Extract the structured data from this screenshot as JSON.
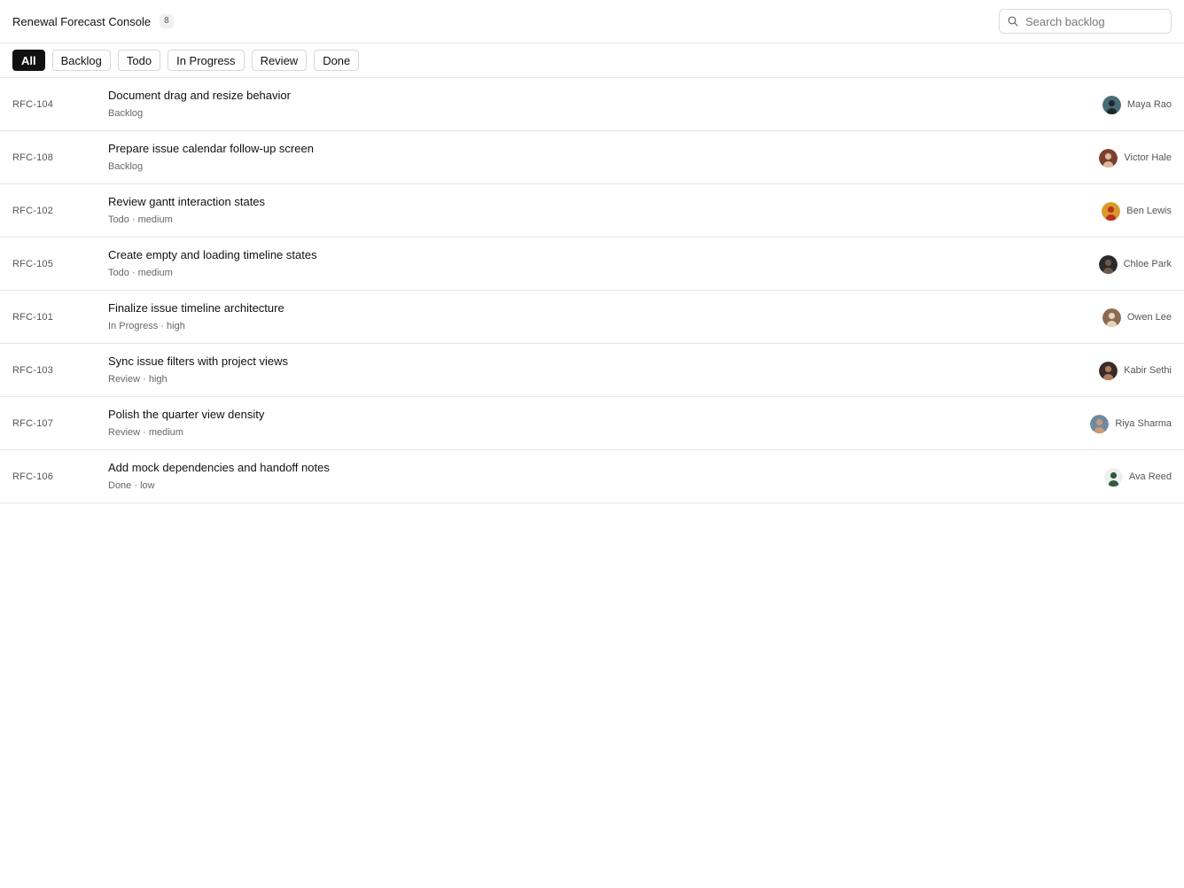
{
  "header": {
    "title": "Renewal Forecast Console",
    "count": "8",
    "search_placeholder": "Search backlog"
  },
  "tabs": [
    {
      "label": "All",
      "active": true
    },
    {
      "label": "Backlog",
      "active": false
    },
    {
      "label": "Todo",
      "active": false
    },
    {
      "label": "In Progress",
      "active": false
    },
    {
      "label": "Review",
      "active": false
    },
    {
      "label": "Done",
      "active": false
    }
  ],
  "issues": [
    {
      "key": "RFC-104",
      "title": "Document drag and resize behavior",
      "meta": "Backlog",
      "assignee": "Maya Rao",
      "avatar_bg": "#4a6b78",
      "avatar_fg": "#1c2a30"
    },
    {
      "key": "RFC-108",
      "title": "Prepare issue calendar follow-up screen",
      "meta": "Backlog",
      "assignee": "Victor Hale",
      "avatar_bg": "#7a3f2e",
      "avatar_fg": "#e0b89a"
    },
    {
      "key": "RFC-102",
      "title": "Review gantt interaction states",
      "meta": "Todo · medium",
      "assignee": "Ben Lewis",
      "avatar_bg": "#d89a2a",
      "avatar_fg": "#b8321f"
    },
    {
      "key": "RFC-105",
      "title": "Create empty and loading timeline states",
      "meta": "Todo · medium",
      "assignee": "Chloe Park",
      "avatar_bg": "#2b2b2b",
      "avatar_fg": "#6b5a4a"
    },
    {
      "key": "RFC-101",
      "title": "Finalize issue timeline architecture",
      "meta": "In Progress · high",
      "assignee": "Owen Lee",
      "avatar_bg": "#8a6a50",
      "avatar_fg": "#e8d2bc"
    },
    {
      "key": "RFC-103",
      "title": "Sync issue filters with project views",
      "meta": "Review · high",
      "assignee": "Kabir Sethi",
      "avatar_bg": "#3a2a28",
      "avatar_fg": "#b07a5e"
    },
    {
      "key": "RFC-107",
      "title": "Polish the quarter view density",
      "meta": "Review · medium",
      "assignee": "Riya Sharma",
      "avatar_bg": "#6f8aa0",
      "avatar_fg": "#c89a7a"
    },
    {
      "key": "RFC-106",
      "title": "Add mock dependencies and handoff notes",
      "meta": "Done · low",
      "assignee": "Ava Reed",
      "avatar_bg": "#eef0ee",
      "avatar_fg": "#2f5a3a"
    }
  ],
  "icons": {
    "search": "search-icon",
    "avatar": "avatar-photo"
  }
}
